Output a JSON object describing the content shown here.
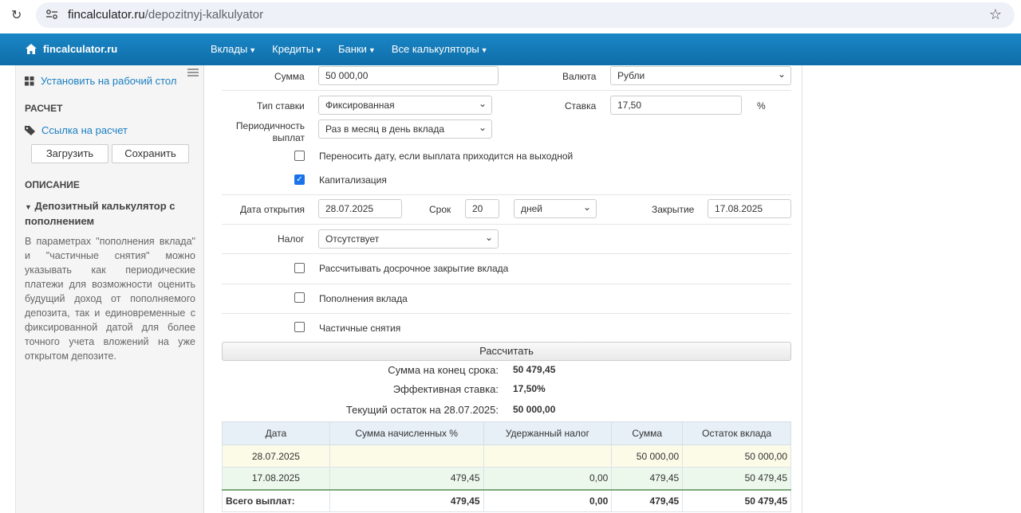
{
  "browser": {
    "url_host": "fincalculator.ru",
    "url_path": "/depozitnyj-kalkulyator"
  },
  "nav": {
    "brand": "fincalculator.ru",
    "items": [
      "Вклады",
      "Кредиты",
      "Банки",
      "Все калькуляторы"
    ]
  },
  "sidebar": {
    "install_link": "Установить на рабочий стол",
    "calc_heading": "РАСЧЕТ",
    "share_link": "Ссылка на расчет",
    "load_button": "Загрузить",
    "save_button": "Сохранить",
    "desc_heading": "ОПИСАНИЕ",
    "desc_title": "Депозитный калькулятор с пополнением",
    "desc_text": "В параметрах \"пополнения вклада\" и \"частичные снятия\" можно указывать как периодические платежи для возможности оценить будущий доход от пополняемого депозита, так и единовременные с фиксированной датой для более точного учета вложений на уже открытом депозите."
  },
  "form": {
    "amount_label": "Сумма",
    "amount_value": "50 000,00",
    "currency_label": "Валюта",
    "currency_value": "Рубли",
    "rate_type_label": "Тип ставки",
    "rate_type_value": "Фиксированная",
    "rate_label": "Ставка",
    "rate_value": "17,50",
    "rate_unit": "%",
    "payout_label_1": "Периодичность",
    "payout_label_2": "выплат",
    "payout_value": "Раз в месяц в день вклада",
    "move_date_label": "Переносить дату, если выплата приходится на выходной",
    "move_date_checked": false,
    "capitalization_label": "Капитализация",
    "capitalization_checked": true,
    "open_date_label": "Дата открытия",
    "open_date_value": "28.07.2025",
    "term_label": "Срок",
    "term_value": "20",
    "term_unit_value": "дней",
    "close_label": "Закрытие",
    "close_value": "17.08.2025",
    "tax_label": "Налог",
    "tax_value": "Отсутствует",
    "early_close_label": "Рассчитывать досрочное закрытие вклада",
    "topups_label": "Пополнения вклада",
    "withdrawals_label": "Частичные снятия",
    "calculate_button": "Рассчитать"
  },
  "results": {
    "end_sum_label": "Сумма на конец срока:",
    "end_sum_value": "50 479,45",
    "eff_rate_label": "Эффективная ставка:",
    "eff_rate_value": "17,50%",
    "balance_label": "Текущий остаток на 28.07.2025:",
    "balance_value": "50 000,00"
  },
  "table": {
    "headers": [
      "Дата",
      "Сумма начисленных %",
      "Удержанный налог",
      "Сумма",
      "Остаток вклада"
    ],
    "rows": [
      [
        "28.07.2025",
        "",
        "",
        "50 000,00",
        "50 000,00"
      ],
      [
        "17.08.2025",
        "479,45",
        "0,00",
        "479,45",
        "50 479,45"
      ]
    ],
    "total": [
      "Всего выплат:",
      "479,45",
      "0,00",
      "479,45",
      "50 479,45"
    ]
  }
}
